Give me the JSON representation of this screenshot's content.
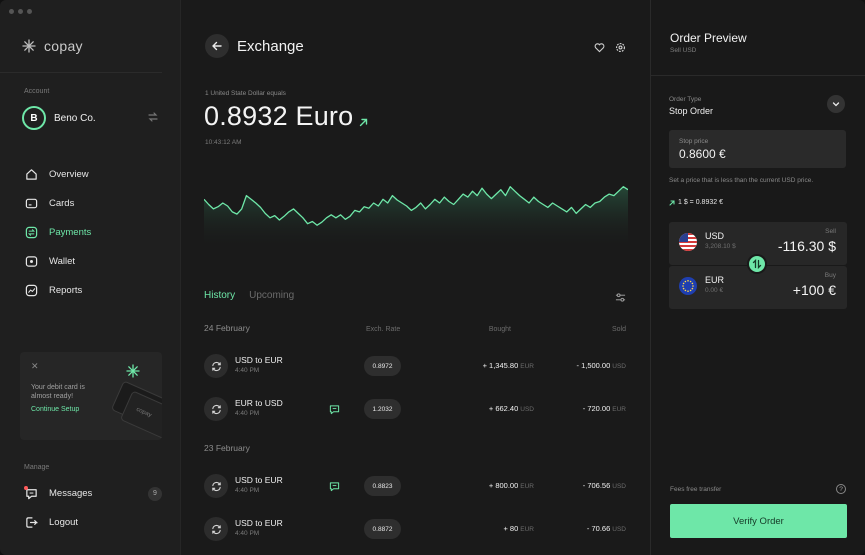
{
  "app": {
    "name": "copay"
  },
  "sidebar": {
    "account_label": "Account",
    "account": {
      "initial": "B",
      "name": "Beno Co."
    },
    "nav": [
      {
        "label": "Overview",
        "icon": "home-icon",
        "active": false
      },
      {
        "label": "Cards",
        "icon": "card-icon",
        "active": false
      },
      {
        "label": "Payments",
        "icon": "payments-icon",
        "active": true
      },
      {
        "label": "Wallet",
        "icon": "wallet-icon",
        "active": false
      },
      {
        "label": "Reports",
        "icon": "reports-icon",
        "active": false
      }
    ],
    "promo": {
      "text": "Your debit card is almost ready!",
      "cta": "Continue Setup",
      "card_brand": "copay"
    },
    "manage_label": "Manage",
    "manage": [
      {
        "label": "Messages",
        "badge": "9"
      },
      {
        "label": "Logout"
      }
    ]
  },
  "main": {
    "title": "Exchange",
    "equals_label": "1 United State Dollar equals",
    "rate": "0.8932 Euro",
    "time": "10:43:12 AM",
    "tabs": [
      {
        "label": "History",
        "active": true
      },
      {
        "label": "Upcoming",
        "active": false
      }
    ],
    "columns": {
      "rate": "Exch. Rate",
      "bought": "Bought",
      "sold": "Sold"
    },
    "groups": [
      {
        "date": "24 February",
        "rows": [
          {
            "title": "USD to EUR",
            "time": "4:40 PM",
            "chat": false,
            "rate": "0.8972",
            "bought": "+ 1,345.80",
            "bought_unit": "EUR",
            "sold": "- 1,500.00",
            "sold_unit": "USD"
          },
          {
            "title": "EUR to USD",
            "time": "4:40 PM",
            "chat": true,
            "rate": "1.2032",
            "bought": "+ 662.40",
            "bought_unit": "USD",
            "sold": "- 720.00",
            "sold_unit": "EUR"
          }
        ]
      },
      {
        "date": "23 February",
        "rows": [
          {
            "title": "USD to EUR",
            "time": "4:40 PM",
            "chat": true,
            "rate": "0.8823",
            "bought": "+ 800.00",
            "bought_unit": "EUR",
            "sold": "- 706.56",
            "sold_unit": "USD"
          },
          {
            "title": "USD to EUR",
            "time": "4:40 PM",
            "chat": false,
            "rate": "0.8872",
            "bought": "+ 80",
            "bought_unit": "EUR",
            "sold": "- 70.66",
            "sold_unit": "USD"
          }
        ]
      }
    ],
    "chart_series": [
      0.55,
      0.48,
      0.42,
      0.45,
      0.5,
      0.46,
      0.38,
      0.35,
      0.42,
      0.6,
      0.55,
      0.5,
      0.44,
      0.36,
      0.3,
      0.33,
      0.27,
      0.32,
      0.38,
      0.42,
      0.36,
      0.3,
      0.22,
      0.25,
      0.2,
      0.24,
      0.3,
      0.34,
      0.3,
      0.34,
      0.28,
      0.32,
      0.4,
      0.38,
      0.45,
      0.43,
      0.5,
      0.46,
      0.55,
      0.5,
      0.6,
      0.54,
      0.5,
      0.46,
      0.4,
      0.44,
      0.5,
      0.42,
      0.48,
      0.55,
      0.5,
      0.58,
      0.52,
      0.48,
      0.55,
      0.62,
      0.58,
      0.66,
      0.6,
      0.7,
      0.62,
      0.56,
      0.62,
      0.68,
      0.6,
      0.72,
      0.66,
      0.6,
      0.55,
      0.5,
      0.58,
      0.52,
      0.48,
      0.44,
      0.5,
      0.46,
      0.42,
      0.38,
      0.44,
      0.36,
      0.42,
      0.48,
      0.44,
      0.5,
      0.52,
      0.58,
      0.62,
      0.6,
      0.66,
      0.72,
      0.68
    ]
  },
  "order": {
    "title": "Order Preview",
    "subtitle": "Sell USD",
    "type_label": "Order Type",
    "type_value": "Stop Order",
    "stop_label": "Stop price",
    "stop_value": "0.8600 €",
    "hint": "Set a price that is less than the current USD price.",
    "rate_line": "1 $ = 0.8932 €",
    "sell": {
      "code": "USD",
      "balance": "3,208.10 $",
      "side": "Sell",
      "amount": "-116.30 $"
    },
    "buy": {
      "code": "EUR",
      "balance": "0.00 €",
      "side": "Buy",
      "amount": "+100 €"
    },
    "fees": "Fees free transfer",
    "verify": "Verify Order"
  },
  "colors": {
    "accent": "#6ee7a8",
    "bg": "#1a1a1a",
    "panel": "#272727"
  }
}
